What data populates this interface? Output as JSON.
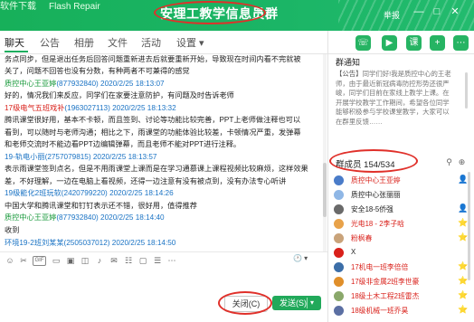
{
  "window": {
    "top_fragments": [
      "软件下载",
      "Flash Repair"
    ],
    "title": "安理工教学信息员群",
    "report_label": "举报",
    "controls": [
      "—",
      "□",
      "✕"
    ]
  },
  "tabs": [
    "聊天",
    "公告",
    "相册",
    "文件",
    "活动",
    "设置 ▾"
  ],
  "tools": [
    "phone-icon",
    "video-icon",
    "class-icon",
    "add-app-icon",
    "more-icon"
  ],
  "messages": [
    {
      "kind": "body",
      "text": "务点同步，但是退出任务后回答问题重新进去后就要重新开始，导致现在时间内看不完就被"
    },
    {
      "kind": "body",
      "text": "关了，问题不回答也没有分数，有种两者不可兼得的感觉"
    },
    {
      "kind": "sender",
      "color": "green",
      "name": "质控中心王亚婷",
      "qq": "(877932840)",
      "time": " 2020/2/25 18:13:07"
    },
    {
      "kind": "body",
      "text": "好的，情况我们来反应，同学们在家要注意防护，有问题及时告诉老师"
    },
    {
      "kind": "sender",
      "color": "red",
      "name": "17级电气五班戏补",
      "qq": "(1963027113)",
      "time": " 2020/2/25 18:13:32"
    },
    {
      "kind": "body",
      "text": "腾讯课堂很好用，基本不卡顿，而且签到、讨论等功能比较完善，PPT上老师做注释也可以"
    },
    {
      "kind": "body",
      "text": "看到，可以随时与老师沟通；相比之下，雨课堂的功能体验比较差，卡顿情况严重，发弹幕"
    },
    {
      "kind": "body",
      "text": "和老师交流时不能边看PPT边编辑弹幕，而且老师不能对PPT进行注释。"
    },
    {
      "kind": "sender",
      "color": "blue",
      "name": "19-轨电小丽",
      "qq": "(2757079815)",
      "time": " 2020/2/25 18:13:57"
    },
    {
      "kind": "body",
      "text": "表示雨课堂签到点名，但是不用雨课堂上课而是在学习通慕课上课程视频比较麻烦，这样效果"
    },
    {
      "kind": "body",
      "text": "差，不好理解，一边在电脑上看视频，还得一边注意有没有被点到，没有办法专心听讲"
    },
    {
      "kind": "sender",
      "color": "blue",
      "name": "19级能化2班玩软",
      "qq": "(2420799220)",
      "time": " 2020/2/25 18:14:26"
    },
    {
      "kind": "body",
      "text": "中国大学和腾讯课堂和钉钉表示还不错，很好用，值得推荐"
    },
    {
      "kind": "sender",
      "color": "green",
      "name": "质控中心王亚婷",
      "qq": "(877932840)",
      "time": " 2020/2/25 18:14:40"
    },
    {
      "kind": "body",
      "text": "收到"
    },
    {
      "kind": "sender",
      "color": "blue",
      "name": "环境19-2班刘某某",
      "qq": "(2505037012)",
      "time": " 2020/2/25 18:14:50"
    }
  ],
  "input_tools": [
    "emoji-icon",
    "scissors-icon",
    "gif-icon",
    "file-icon",
    "image-icon",
    "photo-icon",
    "mic-icon",
    "red-packet-icon",
    "present-icon",
    "screen-icon",
    "vote-icon",
    "more-dots-icon"
  ],
  "history_label": "🕐 ▾",
  "close_label": "关闭(C)",
  "send_label": "发送(S)",
  "notice": {
    "header": "群通知",
    "tag": "【公告】",
    "text": "同学们好!我是质控中心的王老师，由于最近新冠病毒防控形势还很严峻，同学们目前在家线上教学上课。在开展学校教学工作期间，希望各位同学能够积极参与学校课堂教学，大家可以在群里反馈……"
  },
  "members": {
    "header": "群成员",
    "count": "154/534",
    "list": [
      {
        "name": "质控中心王亚婷",
        "color": "#d9201a",
        "avatar": "#4a7cc9",
        "badge": "👤"
      },
      {
        "name": "质控中心张丽丽",
        "color": "#222222",
        "avatar": "#8fb7e6",
        "badge": ""
      },
      {
        "name": "安全18-5侨强",
        "color": "#222222",
        "avatar": "#6a6a6a",
        "badge": "👤"
      },
      {
        "name": "光电18 - 2李子晗",
        "color": "#d9201a",
        "avatar": "#e8a24a",
        "badge": "⭐"
      },
      {
        "name": "粉枫春",
        "color": "#d9201a",
        "avatar": "#c9a37a",
        "badge": "⭐"
      },
      {
        "name": "X",
        "color": "#222222",
        "avatar": "#d9201a",
        "badge": ""
      },
      {
        "name": "17机电一班李倍倍",
        "color": "#d9201a",
        "avatar": "#3c6ea8",
        "badge": "⭐"
      },
      {
        "name": "17级非金属2班李世豪",
        "color": "#d9201a",
        "avatar": "#e08f2a",
        "badge": "⭐"
      },
      {
        "name": "18级土木工程2班雷杰",
        "color": "#d9201a",
        "avatar": "#8aa86b",
        "badge": "⭐"
      },
      {
        "name": "18级机械一班乔昊",
        "color": "#d9201a",
        "avatar": "#5b6fa3",
        "badge": "⭐"
      }
    ]
  }
}
